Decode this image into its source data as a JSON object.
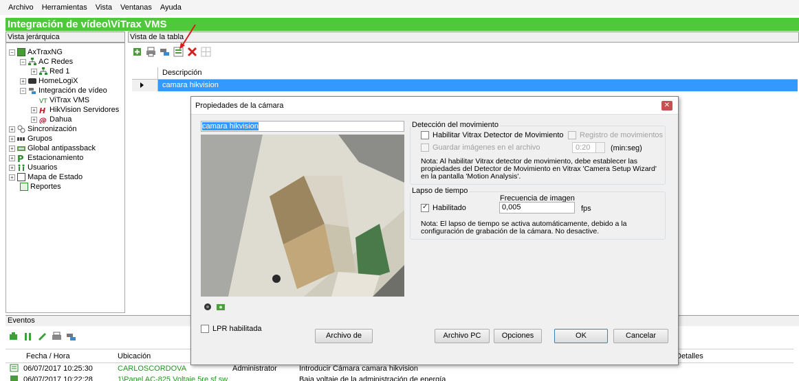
{
  "menu": [
    "Archivo",
    "Herramientas",
    "Vista",
    "Ventanas",
    "Ayuda"
  ],
  "app_title": "Integración de vídeo\\ViTrax VMS",
  "panes": {
    "tree_header": "Vista jerárquica",
    "table_header": "Vista de la tabla"
  },
  "tree": [
    {
      "label": "AxTraxNG",
      "icon": "server-icon",
      "exp": "−"
    },
    {
      "label": "AC Redes",
      "icon": "network-icon",
      "exp": "−"
    },
    {
      "label": "Red 1",
      "icon": "network-icon",
      "exp": "+"
    },
    {
      "label": "HomeLogiX",
      "icon": "homelogix-icon",
      "exp": "+"
    },
    {
      "label": "Integración de vídeo",
      "icon": "video-integration-icon",
      "exp": "−"
    },
    {
      "label": "ViTrax VMS",
      "icon": "vitrax-icon",
      "exp": ""
    },
    {
      "label": "HikVision Servidores",
      "icon": "hikvision-icon",
      "exp": "+"
    },
    {
      "label": "Dahua",
      "icon": "dahua-icon",
      "exp": "+"
    },
    {
      "label": "Sincronización",
      "icon": "sync-icon",
      "exp": "+"
    },
    {
      "label": "Grupos",
      "icon": "groups-icon",
      "exp": "+"
    },
    {
      "label": "Global antipassback",
      "icon": "antipassback-icon",
      "exp": "+"
    },
    {
      "label": "Estacionamiento",
      "icon": "parking-icon",
      "exp": "+"
    },
    {
      "label": "Usuarios",
      "icon": "users-icon",
      "exp": "+"
    },
    {
      "label": "Mapa de Estado",
      "icon": "map-icon",
      "exp": "+"
    },
    {
      "label": "Reportes",
      "icon": "reports-icon",
      "exp": ""
    }
  ],
  "table": {
    "column": "Descripción",
    "rows": [
      "camara hikvision"
    ]
  },
  "events": {
    "title": "Eventos",
    "columns": [
      "Fecha / Hora",
      "Ubicación",
      "Detalles"
    ],
    "rows": [
      {
        "time": "06/07/2017 10:25:30",
        "location": "CARLOSCORDOVA",
        "operator": "Administrator",
        "desc": "Introducir Cámara camara hikvision"
      },
      {
        "time": "06/07/2017 10:22:28",
        "location": "1\\Panel AC-825 Voltaje 5re sf sw",
        "operator": "",
        "desc": "Baja voltaje de la administración de energía"
      }
    ]
  },
  "dialog": {
    "title": "Propiedades de la cámara",
    "camera_name": "camara hikvision",
    "lpr_label": "LPR habilitada",
    "motion": {
      "group": "Detección del movimiento",
      "enable_label": "Habilitar Vitrax Detector de Movimiento",
      "log_label": "Registro de movimientos",
      "save_label": "Guardar imágenes en el archivo",
      "time_value": "0:20",
      "time_unit": "(min:seg)",
      "note": "Nota: Al habilitar Vitrax detector de movimiento, debe establecer las propiedades del Detector de Movimiento en Vitrax 'Camera Setup Wizard' en la pantalla 'Motion Analysis'."
    },
    "timelapse": {
      "group": "Lapso de tiempo",
      "enabled_label": "Habilitado",
      "freq_label": "Frecuencia de imagen",
      "freq_value": "0,005",
      "freq_unit": "fps",
      "note": "Nota: El lapso de tiempo se activa automáticamente, debido a la configuración de grabación de la cámara. No desactive."
    },
    "buttons": {
      "archive": "Archivo de",
      "archive_pc": "Archivo PC",
      "options": "Opciones",
      "ok": "OK",
      "cancel": "Cancelar"
    }
  }
}
